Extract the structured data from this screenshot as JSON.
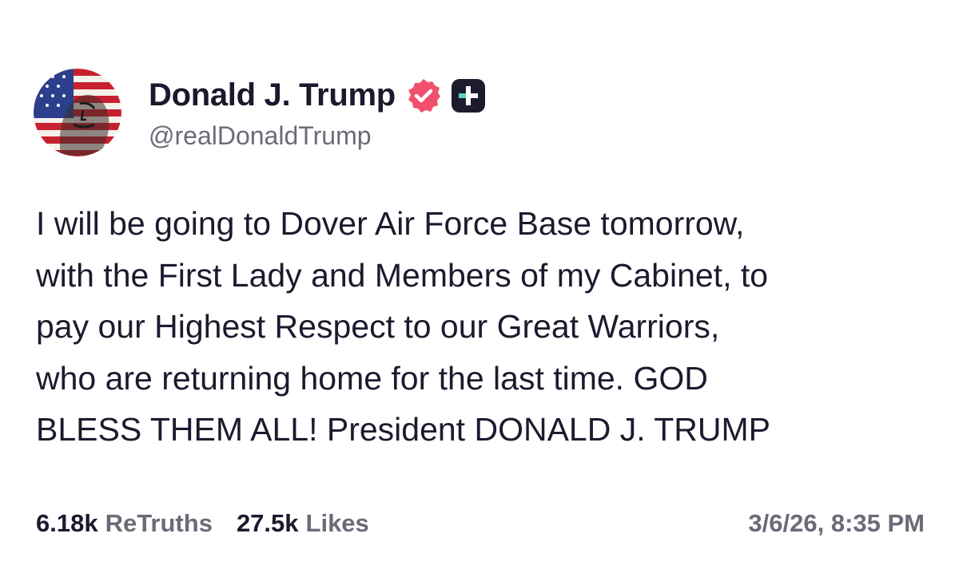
{
  "author": {
    "display_name": "Donald J. Trump",
    "handle": "@realDonaldTrump",
    "avatar_icon": "flag-portrait-avatar",
    "verified_icon": "verified-badge-icon",
    "plus_icon": "plus-badge-icon"
  },
  "post": {
    "text": "I will be going to Dover Air Force Base tomorrow,\nwith the First Lady and Members of my Cabinet, to\npay our Highest Respect to our Great Warriors,\nwho are returning home for the last time. GOD\nBLESS THEM ALL! President DONALD J. TRUMP"
  },
  "stats": {
    "retruths_count": "6.18k",
    "retruths_label": "ReTruths",
    "likes_count": "27.5k",
    "likes_label": "Likes",
    "timestamp": "3/6/26, 8:35 PM"
  },
  "colors": {
    "verified": "#f0506e",
    "plus_badge_bg": "#1c1c2e",
    "plus_badge_accent": "#5fd3c1",
    "muted_text": "#6b6b78",
    "primary_text": "#1b1b2f"
  }
}
